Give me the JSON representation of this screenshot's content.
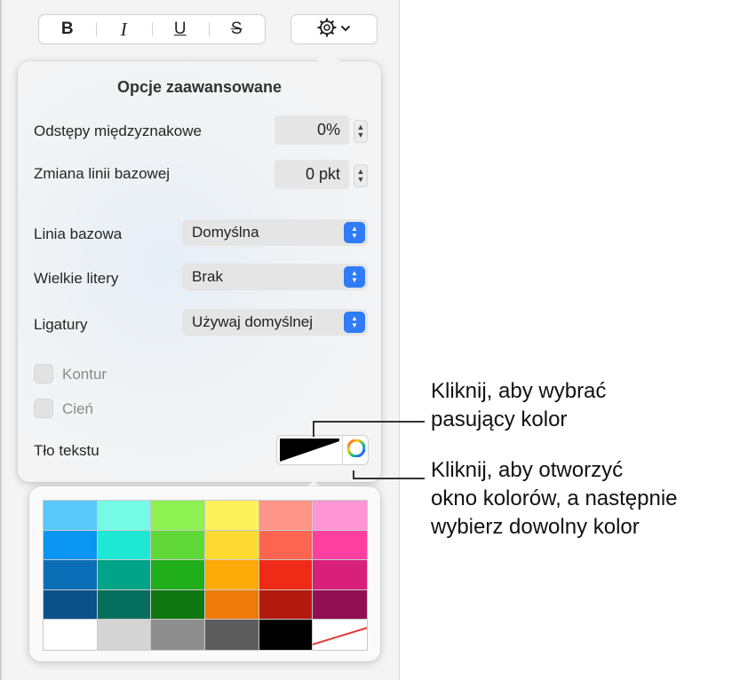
{
  "toolbar": {
    "bold": "B",
    "italic": "I",
    "underline": "U",
    "strikethrough": "S",
    "gear_chevron": "⌄"
  },
  "popover": {
    "title": "Opcje zaawansowane",
    "character_spacing": {
      "label": "Odstępy międzyznakowe",
      "value": "0%"
    },
    "baseline_shift": {
      "label": "Zmiana linii bazowej",
      "value": "0 pkt"
    },
    "baseline": {
      "label": "Linia bazowa",
      "value": "Domyślna"
    },
    "capitalization": {
      "label": "Wielkie litery",
      "value": "Brak"
    },
    "ligatures": {
      "label": "Ligatury",
      "value": "Używaj domyślnej"
    },
    "outline": {
      "label": "Kontur",
      "checked": false
    },
    "shadow": {
      "label": "Cień",
      "checked": false
    },
    "text_background": {
      "label": "Tło tekstu"
    }
  },
  "palette": {
    "colors": [
      "#5ac8fa",
      "#75fbe6",
      "#8df152",
      "#fef25a",
      "#ff9488",
      "#ff96d4",
      "#0a95f0",
      "#1ee8d3",
      "#5fd838",
      "#fdd932",
      "#fd6551",
      "#ff3fa0",
      "#0a6fb6",
      "#00a488",
      "#21ae1b",
      "#fcaa08",
      "#ef2a17",
      "#d81f7a",
      "#0b5289",
      "#066e5c",
      "#0f7610",
      "#f07a09",
      "#b3190c",
      "#930f54",
      "#ffffff",
      "#d4d4d4",
      "#8e8e8e",
      "#5d5d5d",
      "#000000",
      "none"
    ]
  },
  "callouts": {
    "match_color": [
      "Kliknij, aby wybrać",
      "pasujący kolor"
    ],
    "color_window": [
      "Kliknij, aby otworzyć",
      "okno kolorów, a następnie",
      "wybierz dowolny kolor"
    ]
  }
}
